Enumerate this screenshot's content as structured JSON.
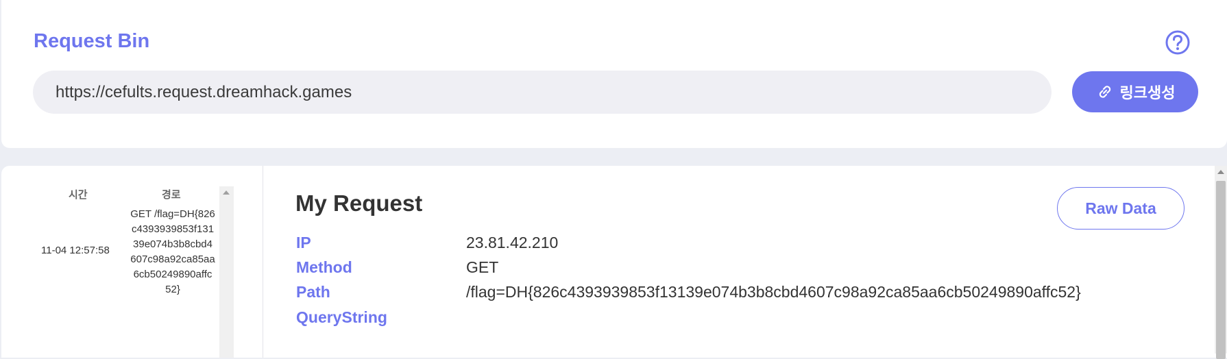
{
  "header": {
    "title": "Request Bin",
    "url": "https://cefults.request.dreamhack.games",
    "link_button_label": "링크생성",
    "help_icon": "question-circle-icon",
    "link_icon": "link-icon"
  },
  "request_list": {
    "columns": [
      "시간",
      "경로"
    ],
    "rows": [
      {
        "time": "11-04 12:57:58",
        "path_lines": [
          "GET /flag=DH{826",
          "c4393939853f131",
          "39e074b3b8cbd4",
          "607c98a92ca85aa",
          "6cb50249890affc",
          "52}"
        ]
      }
    ]
  },
  "detail": {
    "title": "My Request",
    "raw_button_label": "Raw Data",
    "fields": [
      {
        "label": "IP",
        "value": "23.81.42.210"
      },
      {
        "label": "Method",
        "value": "GET"
      },
      {
        "label": "Path",
        "value": "/flag=DH{826c4393939853f13139e074b3b8cbd4607c98a92ca85aa6cb50249890affc52}"
      },
      {
        "label": "QueryString",
        "value": ""
      }
    ]
  },
  "colors": {
    "accent": "#6e76ee",
    "background": "#eceef4",
    "input_bg": "#efeff4"
  }
}
